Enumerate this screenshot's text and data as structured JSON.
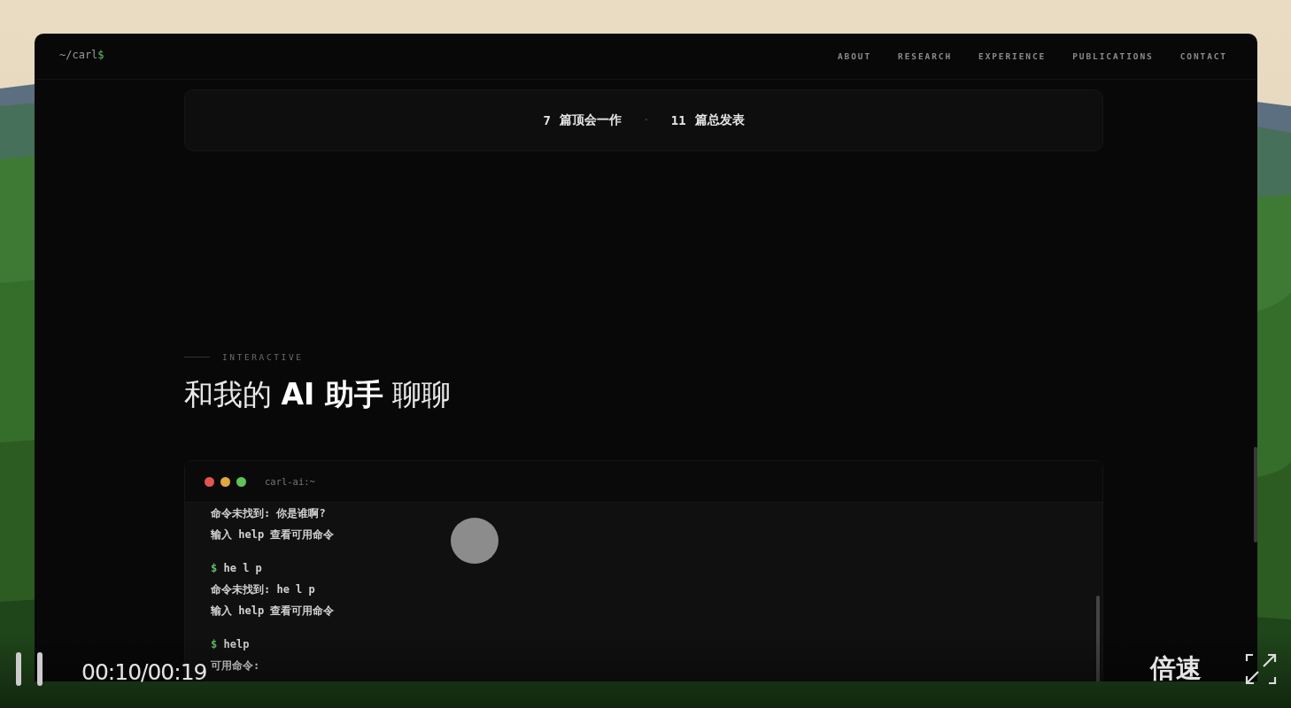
{
  "site": {
    "logo": {
      "path": "~/carl",
      "prompt": "$"
    },
    "nav": [
      "ABOUT",
      "RESEARCH",
      "EXPERIENCE",
      "PUBLICATIONS",
      "CONTACT"
    ],
    "stats": [
      {
        "number": "7",
        "label": "篇顶会一作"
      },
      {
        "number": "11",
        "label": "篇总发表"
      }
    ],
    "stats_separator": "·",
    "section": {
      "eyebrow": "INTERACTIVE",
      "title": "和我的 **AI 助手** 聊聊"
    },
    "terminal": {
      "title": "carl-ai:~",
      "lines": [
        {
          "kind": "output",
          "text": "命令未找到: 你是谁啊?"
        },
        {
          "kind": "output",
          "text": "输入 help 查看可用命令"
        },
        {
          "kind": "input",
          "prompt": "$",
          "text": "he l p"
        },
        {
          "kind": "output",
          "text": "命令未找到: he l p"
        },
        {
          "kind": "output",
          "text": "输入 help 查看可用命令"
        },
        {
          "kind": "input",
          "prompt": "$",
          "text": "help"
        },
        {
          "kind": "output",
          "text": "可用命令:"
        }
      ]
    }
  },
  "player": {
    "playing": true,
    "time": "00:10/00:19",
    "speed_label": "倍速"
  }
}
